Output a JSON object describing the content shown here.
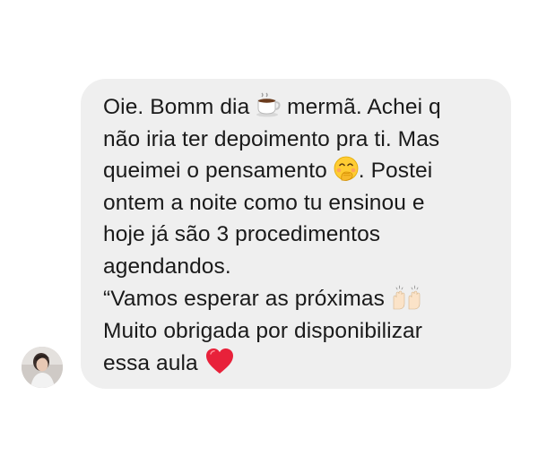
{
  "conversation": {
    "message": {
      "lines": [
        {
          "before": "Oie. Bomm dia ",
          "icon": "hot-beverage-emoji",
          "after": " mermã. Achei q"
        },
        {
          "text": "não iria ter depoimento pra ti. Mas"
        },
        {
          "before": "queimei o pensamento ",
          "icon": "hand-over-mouth-emoji",
          "after": ". Postei"
        },
        {
          "text": "ontem a noite como tu ensinou e"
        },
        {
          "text": "hoje já são 3 procedimentos"
        },
        {
          "text": "agendandos."
        },
        {
          "before": "“Vamos esperar as próximas ",
          "icon": "raising-hands-emoji",
          "after": ""
        },
        {
          "text": "Muito obrigada por disponibilizar"
        },
        {
          "before": "essa aula ",
          "icon": "red-heart-emoji",
          "after": ""
        }
      ]
    },
    "sender": {
      "avatar_icon": "profile-photo"
    }
  },
  "colors": {
    "bubble_background": "#efefef",
    "text": "#1a1a1a",
    "page_background": "#ffffff"
  }
}
